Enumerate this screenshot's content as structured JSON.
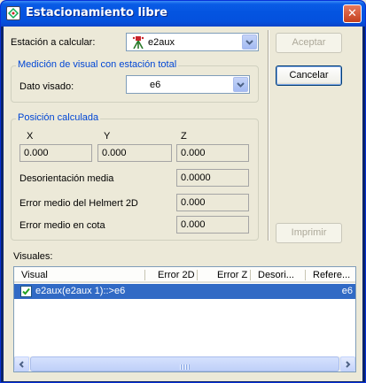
{
  "window": {
    "title": "Estacionamiento libre",
    "close_glyph": "✕"
  },
  "station": {
    "label": "Estación a calcular:",
    "value": "e2aux",
    "icon": "station-tripod-icon"
  },
  "measurement": {
    "group_title": "Medición de visual con estación total",
    "label": "Dato visado:",
    "value": "e6"
  },
  "position": {
    "group_title": "Posición calculada",
    "x_label": "X",
    "y_label": "Y",
    "z_label": "Z",
    "x_value": "0.000",
    "y_value": "0.000",
    "z_value": "0.000",
    "desorientacion_label": "Desorientación media",
    "desorientacion_value": "0.0000",
    "helmert_label": "Error medio del Helmert 2D",
    "helmert_value": "0.000",
    "cota_label": "Error medio en cota",
    "cota_value": "0.000"
  },
  "buttons": {
    "aceptar": "Aceptar",
    "cancelar": "Cancelar",
    "imprimir": "Imprimir"
  },
  "visuales": {
    "label": "Visuales:",
    "columns": [
      "Visual",
      "Error 2D",
      "Error Z",
      "Desori...",
      "Refere..."
    ],
    "rows": [
      {
        "checked": true,
        "visual": "e2aux(e2aux 1)::>e6",
        "referencia": "e6"
      }
    ]
  },
  "colors": {
    "selection": "#316ac5",
    "group_title": "#0046d5",
    "titlebar": "#0454e0"
  }
}
